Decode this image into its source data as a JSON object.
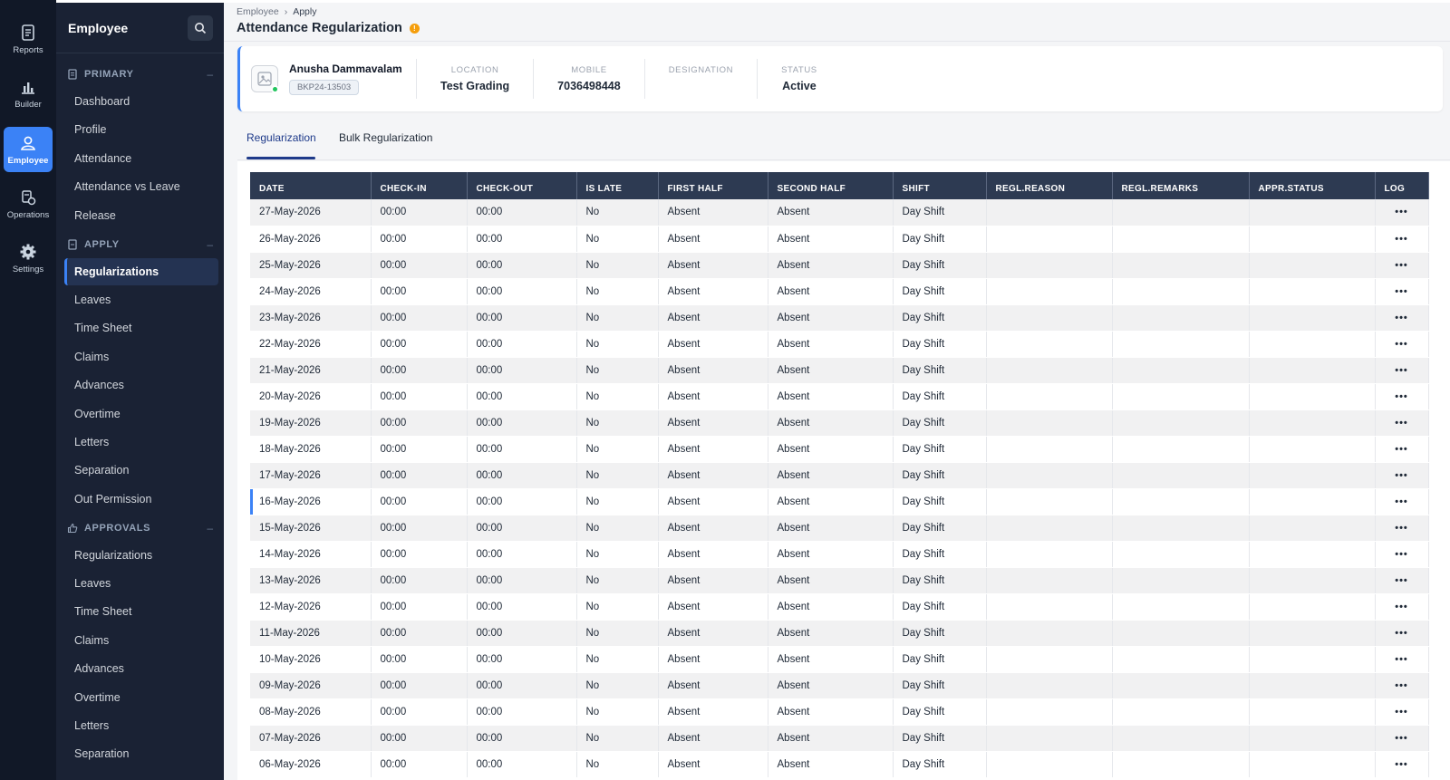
{
  "rail": [
    {
      "label": "Reports",
      "icon": "reports-icon"
    },
    {
      "label": "Builder",
      "icon": "builder-icon"
    },
    {
      "label": "Employee",
      "icon": "employee-icon",
      "active": true
    },
    {
      "label": "Operations",
      "icon": "operations-icon"
    },
    {
      "label": "Settings",
      "icon": "settings-icon"
    }
  ],
  "sidemenu": {
    "title": "Employee",
    "sections": [
      {
        "label": "PRIMARY",
        "items": [
          "Dashboard",
          "Profile",
          "Attendance",
          "Attendance vs Leave",
          "Release"
        ]
      },
      {
        "label": "APPLY",
        "items": [
          "Regularizations",
          "Leaves",
          "Time Sheet",
          "Claims",
          "Advances",
          "Overtime",
          "Letters",
          "Separation",
          "Out Permission"
        ]
      },
      {
        "label": "APPROVALS",
        "items": [
          "Regularizations",
          "Leaves",
          "Time Sheet",
          "Claims",
          "Advances",
          "Overtime",
          "Letters",
          "Separation"
        ]
      }
    ],
    "active_item": "Regularizations"
  },
  "breadcrumb": {
    "parent": "Employee",
    "separator": "›",
    "current": "Apply"
  },
  "page_title": "Attendance Regularization",
  "employee": {
    "name": "Anusha Dammavalam",
    "code": "BKP24-13503",
    "location_label": "LOCATION",
    "location": "Test Grading",
    "mobile_label": "MOBILE",
    "mobile": "7036498448",
    "designation_label": "DESIGNATION",
    "designation": "",
    "status_label": "STATUS",
    "status": "Active"
  },
  "tabs": [
    "Regularization",
    "Bulk Regularization"
  ],
  "table": {
    "columns": [
      "DATE",
      "CHECK-IN",
      "CHECK-OUT",
      "IS LATE",
      "FIRST HALF",
      "SECOND HALF",
      "SHIFT",
      "REGL.REASON",
      "REGL.REMARKS",
      "APPR.STATUS",
      "LOG"
    ],
    "rows": [
      [
        "27-May-2026",
        "00:00",
        "00:00",
        "No",
        "Absent",
        "Absent",
        "Day Shift",
        "",
        "",
        "",
        "•••"
      ],
      [
        "26-May-2026",
        "00:00",
        "00:00",
        "No",
        "Absent",
        "Absent",
        "Day Shift",
        "",
        "",
        "",
        "•••"
      ],
      [
        "25-May-2026",
        "00:00",
        "00:00",
        "No",
        "Absent",
        "Absent",
        "Day Shift",
        "",
        "",
        "",
        "•••"
      ],
      [
        "24-May-2026",
        "00:00",
        "00:00",
        "No",
        "Absent",
        "Absent",
        "Day Shift",
        "",
        "",
        "",
        "•••"
      ],
      [
        "23-May-2026",
        "00:00",
        "00:00",
        "No",
        "Absent",
        "Absent",
        "Day Shift",
        "",
        "",
        "",
        "•••"
      ],
      [
        "22-May-2026",
        "00:00",
        "00:00",
        "No",
        "Absent",
        "Absent",
        "Day Shift",
        "",
        "",
        "",
        "•••"
      ],
      [
        "21-May-2026",
        "00:00",
        "00:00",
        "No",
        "Absent",
        "Absent",
        "Day Shift",
        "",
        "",
        "",
        "•••"
      ],
      [
        "20-May-2026",
        "00:00",
        "00:00",
        "No",
        "Absent",
        "Absent",
        "Day Shift",
        "",
        "",
        "",
        "•••"
      ],
      [
        "19-May-2026",
        "00:00",
        "00:00",
        "No",
        "Absent",
        "Absent",
        "Day Shift",
        "",
        "",
        "",
        "•••"
      ],
      [
        "18-May-2026",
        "00:00",
        "00:00",
        "No",
        "Absent",
        "Absent",
        "Day Shift",
        "",
        "",
        "",
        "•••"
      ],
      [
        "17-May-2026",
        "00:00",
        "00:00",
        "No",
        "Absent",
        "Absent",
        "Day Shift",
        "",
        "",
        "",
        "•••"
      ],
      [
        "16-May-2026",
        "00:00",
        "00:00",
        "No",
        "Absent",
        "Absent",
        "Day Shift",
        "",
        "",
        "",
        "•••"
      ],
      [
        "15-May-2026",
        "00:00",
        "00:00",
        "No",
        "Absent",
        "Absent",
        "Day Shift",
        "",
        "",
        "",
        "•••"
      ],
      [
        "14-May-2026",
        "00:00",
        "00:00",
        "No",
        "Absent",
        "Absent",
        "Day Shift",
        "",
        "",
        "",
        "•••"
      ],
      [
        "13-May-2026",
        "00:00",
        "00:00",
        "No",
        "Absent",
        "Absent",
        "Day Shift",
        "",
        "",
        "",
        "•••"
      ],
      [
        "12-May-2026",
        "00:00",
        "00:00",
        "No",
        "Absent",
        "Absent",
        "Day Shift",
        "",
        "",
        "",
        "•••"
      ],
      [
        "11-May-2026",
        "00:00",
        "00:00",
        "No",
        "Absent",
        "Absent",
        "Day Shift",
        "",
        "",
        "",
        "•••"
      ],
      [
        "10-May-2026",
        "00:00",
        "00:00",
        "No",
        "Absent",
        "Absent",
        "Day Shift",
        "",
        "",
        "",
        "•••"
      ],
      [
        "09-May-2026",
        "00:00",
        "00:00",
        "No",
        "Absent",
        "Absent",
        "Day Shift",
        "",
        "",
        "",
        "•••"
      ],
      [
        "08-May-2026",
        "00:00",
        "00:00",
        "No",
        "Absent",
        "Absent",
        "Day Shift",
        "",
        "",
        "",
        "•••"
      ],
      [
        "07-May-2026",
        "00:00",
        "00:00",
        "No",
        "Absent",
        "Absent",
        "Day Shift",
        "",
        "",
        "",
        "•••"
      ],
      [
        "06-May-2026",
        "00:00",
        "00:00",
        "No",
        "Absent",
        "Absent",
        "Day Shift",
        "",
        "",
        "",
        "•••"
      ]
    ],
    "marked_row": "16-May-2026"
  },
  "colors": {
    "rail_bg": "#111827",
    "menu_bg": "#1a2234",
    "accent": "#3b82f6",
    "header_bg": "#2d3a52",
    "info": "#f59e0b"
  }
}
